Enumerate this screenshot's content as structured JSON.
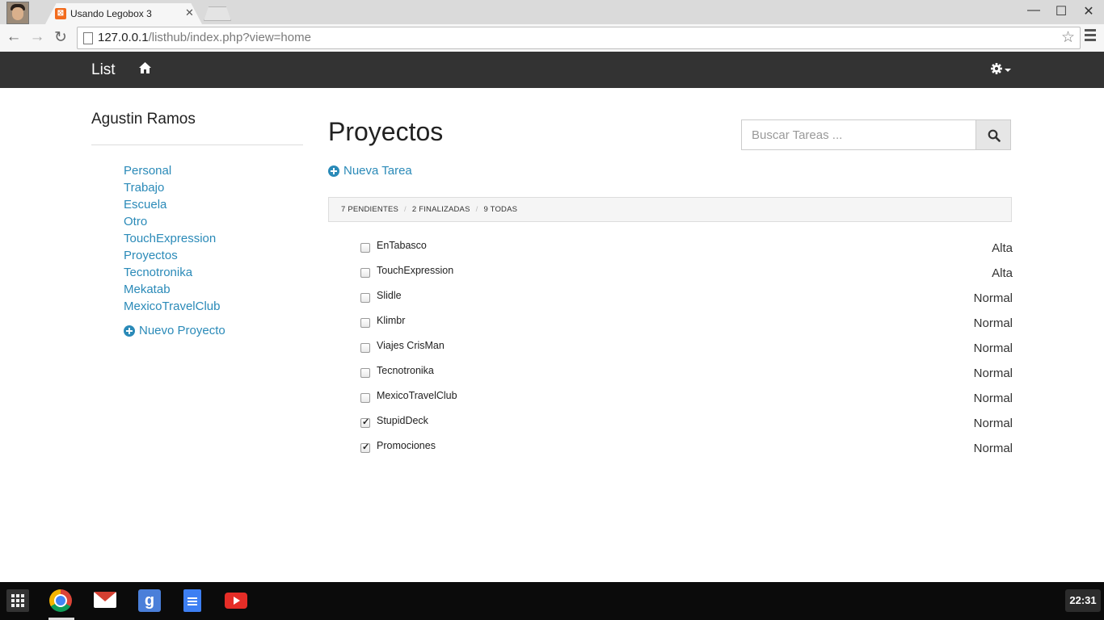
{
  "browser": {
    "tab_title": "Usando Legobox 3",
    "tab_favicon": "xampp-icon",
    "url_host": "127.0.0.1",
    "url_path": "/listhub/index.php?view=home"
  },
  "navbar": {
    "brand": "List",
    "home_icon": "home-icon",
    "settings_icon": "gear-icon"
  },
  "sidebar": {
    "user_name": "Agustin Ramos",
    "projects": [
      {
        "label": "Personal"
      },
      {
        "label": "Trabajo"
      },
      {
        "label": "Escuela"
      },
      {
        "label": "Otro"
      },
      {
        "label": "TouchExpression"
      },
      {
        "label": "Proyectos"
      },
      {
        "label": "Tecnotronika"
      },
      {
        "label": "Mekatab"
      },
      {
        "label": "MexicoTravelClub"
      }
    ],
    "new_project_label": "Nuevo Proyecto"
  },
  "main": {
    "title": "Proyectos",
    "new_task_label": "Nueva Tarea",
    "search": {
      "placeholder": "Buscar Tareas ..."
    },
    "filters": [
      {
        "label": "7 PENDIENTES"
      },
      {
        "label": "2 FINALIZADAS"
      },
      {
        "label": "9 TODAS"
      }
    ],
    "tasks": [
      {
        "name": "EnTabasco",
        "priority": "Alta",
        "done": false
      },
      {
        "name": "TouchExpression",
        "priority": "Alta",
        "done": false
      },
      {
        "name": "Slidle",
        "priority": "Normal",
        "done": false
      },
      {
        "name": "Klimbr",
        "priority": "Normal",
        "done": false
      },
      {
        "name": "Viajes CrisMan",
        "priority": "Normal",
        "done": false
      },
      {
        "name": "Tecnotronika",
        "priority": "Normal",
        "done": false
      },
      {
        "name": "MexicoTravelClub",
        "priority": "Normal",
        "done": false
      },
      {
        "name": "StupidDeck",
        "priority": "Normal",
        "done": true
      },
      {
        "name": "Promociones",
        "priority": "Normal",
        "done": true
      }
    ]
  },
  "taskbar": {
    "apps": [
      "launcher-icon",
      "chrome-icon",
      "gmail-icon",
      "google-search-icon",
      "docs-icon",
      "youtube-icon"
    ],
    "clock": "22:31"
  },
  "colors": {
    "link": "#2a8ab8",
    "navbar_bg": "#333333",
    "taskbar_bg": "#0b0b0b"
  }
}
